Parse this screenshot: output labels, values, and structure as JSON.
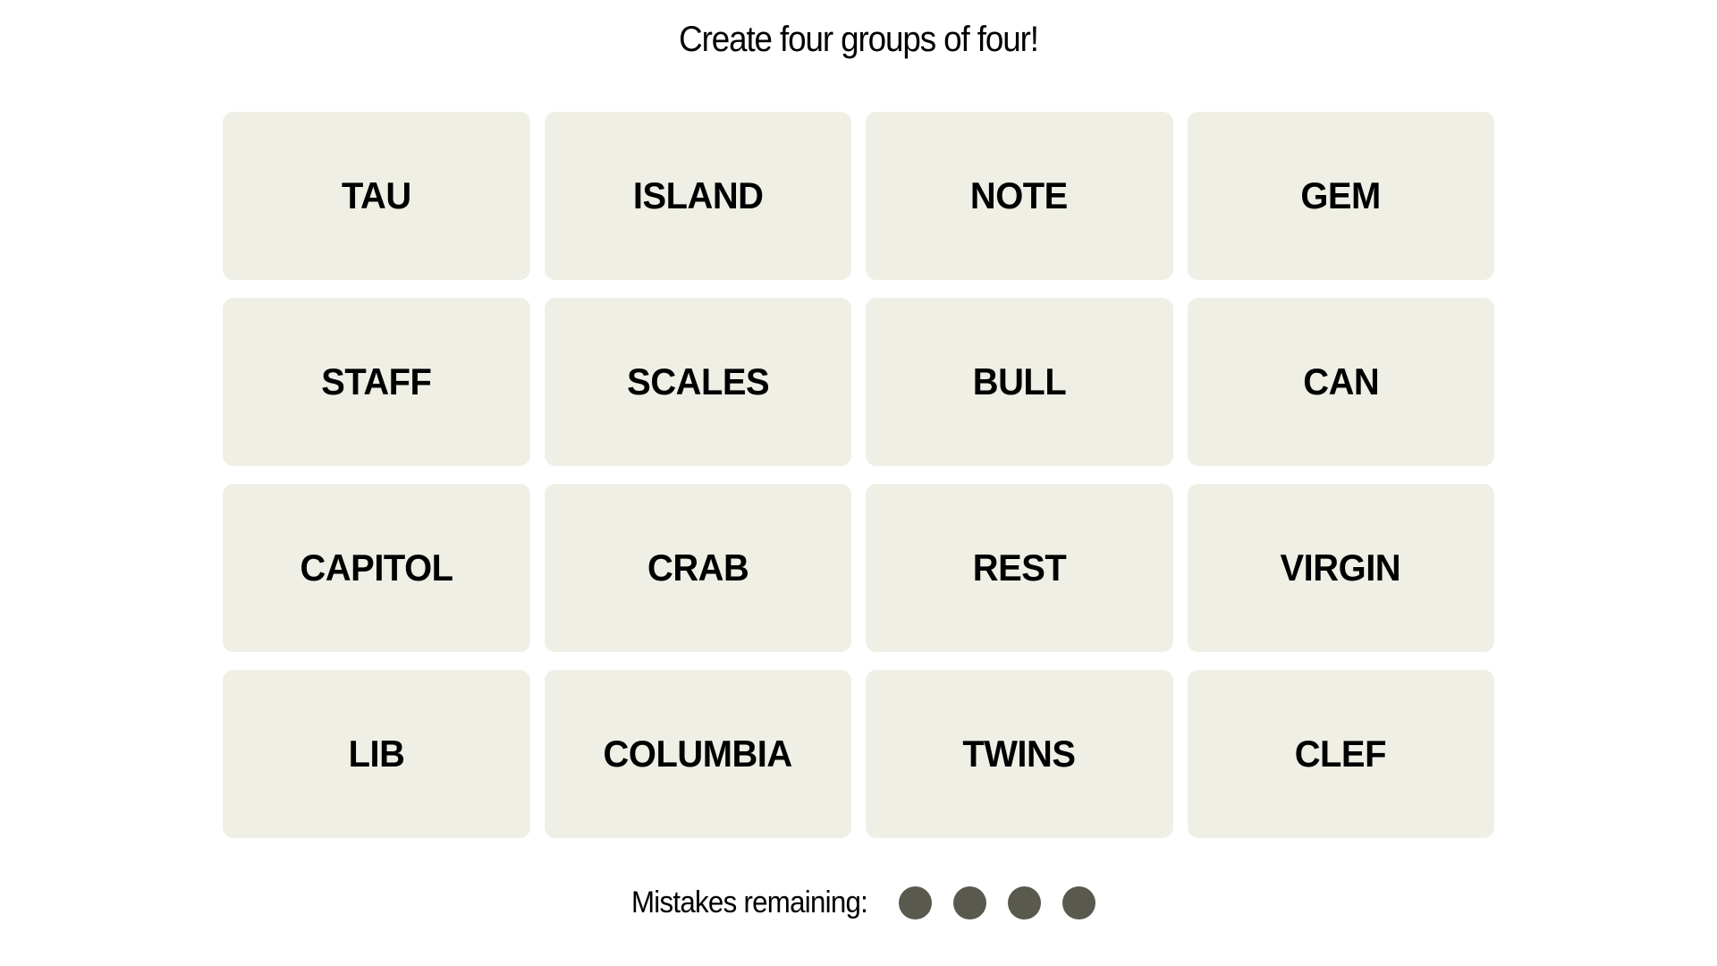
{
  "header": {
    "title": "Create four groups of four!"
  },
  "board": {
    "tiles": [
      "TAU",
      "ISLAND",
      "NOTE",
      "GEM",
      "STAFF",
      "SCALES",
      "BULL",
      "CAN",
      "CAPITOL",
      "CRAB",
      "REST",
      "VIRGIN",
      "LIB",
      "COLUMBIA",
      "TWINS",
      "CLEF"
    ]
  },
  "status": {
    "mistakes_label": "Mistakes remaining:",
    "mistakes_remaining": 4,
    "mistakes_total": 4,
    "dot_color": "#5a594e"
  },
  "colors": {
    "tile_background": "#efefe6",
    "page_background": "#ffffff"
  }
}
